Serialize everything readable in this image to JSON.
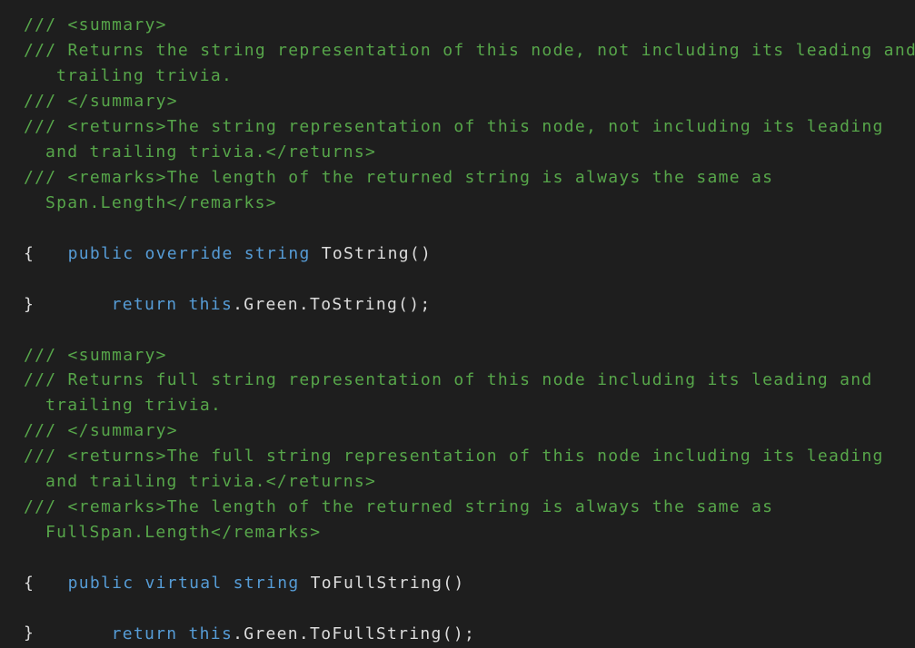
{
  "code": {
    "block1": {
      "summary_open": "/// <summary>",
      "summary_line1": "/// Returns the string representation of this node, not including its leading and",
      "summary_line2": "trailing trivia.",
      "summary_close": "/// </summary>",
      "returns_line1": "/// <returns>The string representation of this node, not including its leading",
      "returns_line2": "and trailing trivia.</returns>",
      "remarks_line1": "/// <remarks>The length of the returned string is always the same as",
      "remarks_line2": "Span.Length</remarks>",
      "sig_public": "public",
      "sig_override": "override",
      "sig_type": "string",
      "sig_name": "ToString()",
      "brace_open": "{",
      "body_return": "return",
      "body_this": "this",
      "body_rest": ".Green.ToString();",
      "brace_close": "}"
    },
    "block2": {
      "summary_open": "/// <summary>",
      "summary_line1": "/// Returns full string representation of this node including its leading and",
      "summary_line2": "trailing trivia.",
      "summary_close": "/// </summary>",
      "returns_line1": "/// <returns>The full string representation of this node including its leading",
      "returns_line2": "and trailing trivia.</returns>",
      "remarks_line1": "/// <remarks>The length of the returned string is always the same as",
      "remarks_line2": "FullSpan.Length</remarks>",
      "sig_public": "public",
      "sig_virtual": "virtual",
      "sig_type": "string",
      "sig_name": "ToFullString()",
      "brace_open": "{",
      "body_return": "return",
      "body_this": "this",
      "body_rest": ".Green.ToFullString();",
      "brace_close": "}"
    }
  },
  "colors": {
    "background": "#1e1e1e",
    "comment": "#57a64a",
    "keyword": "#569cd6",
    "text": "#dcdcdc"
  }
}
